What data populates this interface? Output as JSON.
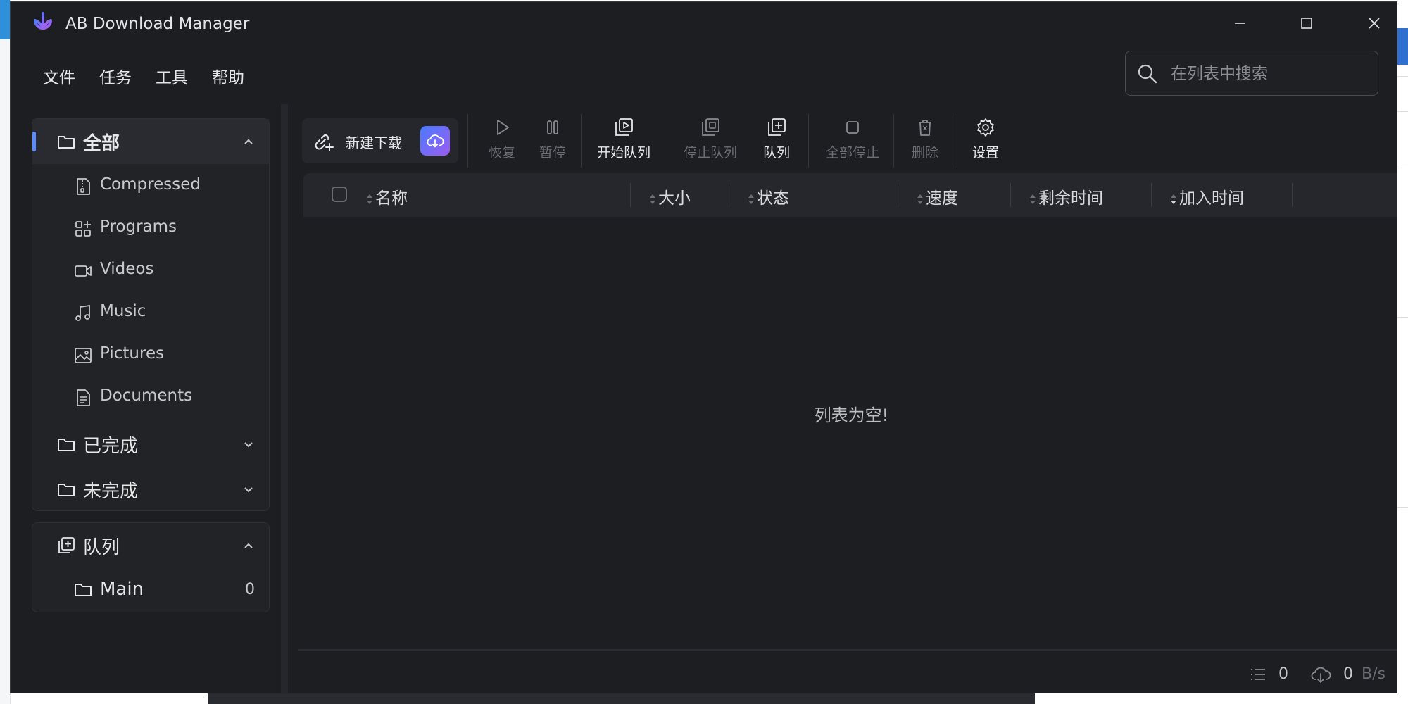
{
  "window": {
    "title": "AB Download Manager",
    "accent": "#5b8cff",
    "background": "#1d1e22"
  },
  "menu": [
    "文件",
    "任务",
    "工具",
    "帮助"
  ],
  "search": {
    "placeholder": "在列表中搜索"
  },
  "sidebar": {
    "all": {
      "label": "全部",
      "items": [
        {
          "label": "Compressed",
          "icon": "zip-file-icon"
        },
        {
          "label": "Programs",
          "icon": "apps-grid-icon"
        },
        {
          "label": "Videos",
          "icon": "video-camera-icon"
        },
        {
          "label": "Music",
          "icon": "music-note-icon"
        },
        {
          "label": "Pictures",
          "icon": "image-icon"
        },
        {
          "label": "Documents",
          "icon": "document-icon"
        }
      ]
    },
    "finished": {
      "label": "已完成"
    },
    "unfinished": {
      "label": "未完成"
    },
    "queues": {
      "label": "队列",
      "items": [
        {
          "label": "Main",
          "count": "0"
        }
      ]
    }
  },
  "toolbar": {
    "new_download": "新建下载",
    "resume": "恢复",
    "pause": "暂停",
    "start_queue": "开始队列",
    "stop_queue": "停止队列",
    "queue": "队列",
    "stop_all": "全部停止",
    "delete": "删除",
    "settings": "设置"
  },
  "table": {
    "columns": [
      "名称",
      "大小",
      "状态",
      "速度",
      "剩余时间",
      "加入时间"
    ],
    "empty_message": "列表为空!"
  },
  "status": {
    "active_count": "0",
    "speed_value": "0",
    "speed_unit": "B/s"
  }
}
